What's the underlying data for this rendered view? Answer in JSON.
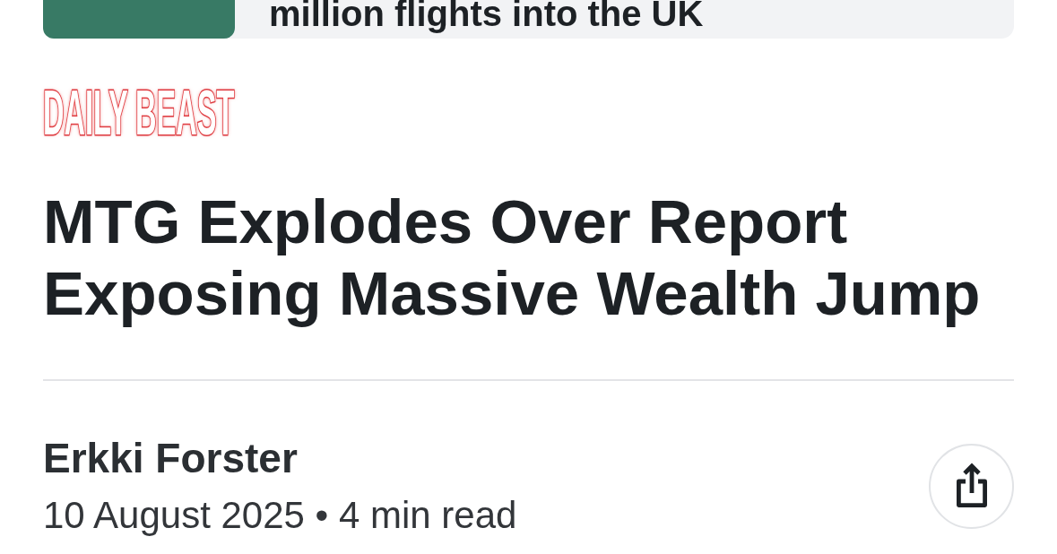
{
  "related_card": {
    "title": "million flights into the UK"
  },
  "article": {
    "source": "DAILY BEAST",
    "headline": "MTG Explodes Over Report Exposing Massive Wealth Jump",
    "author": "Erkki Forster",
    "meta": "10 August 2025 • 4 min read"
  }
}
